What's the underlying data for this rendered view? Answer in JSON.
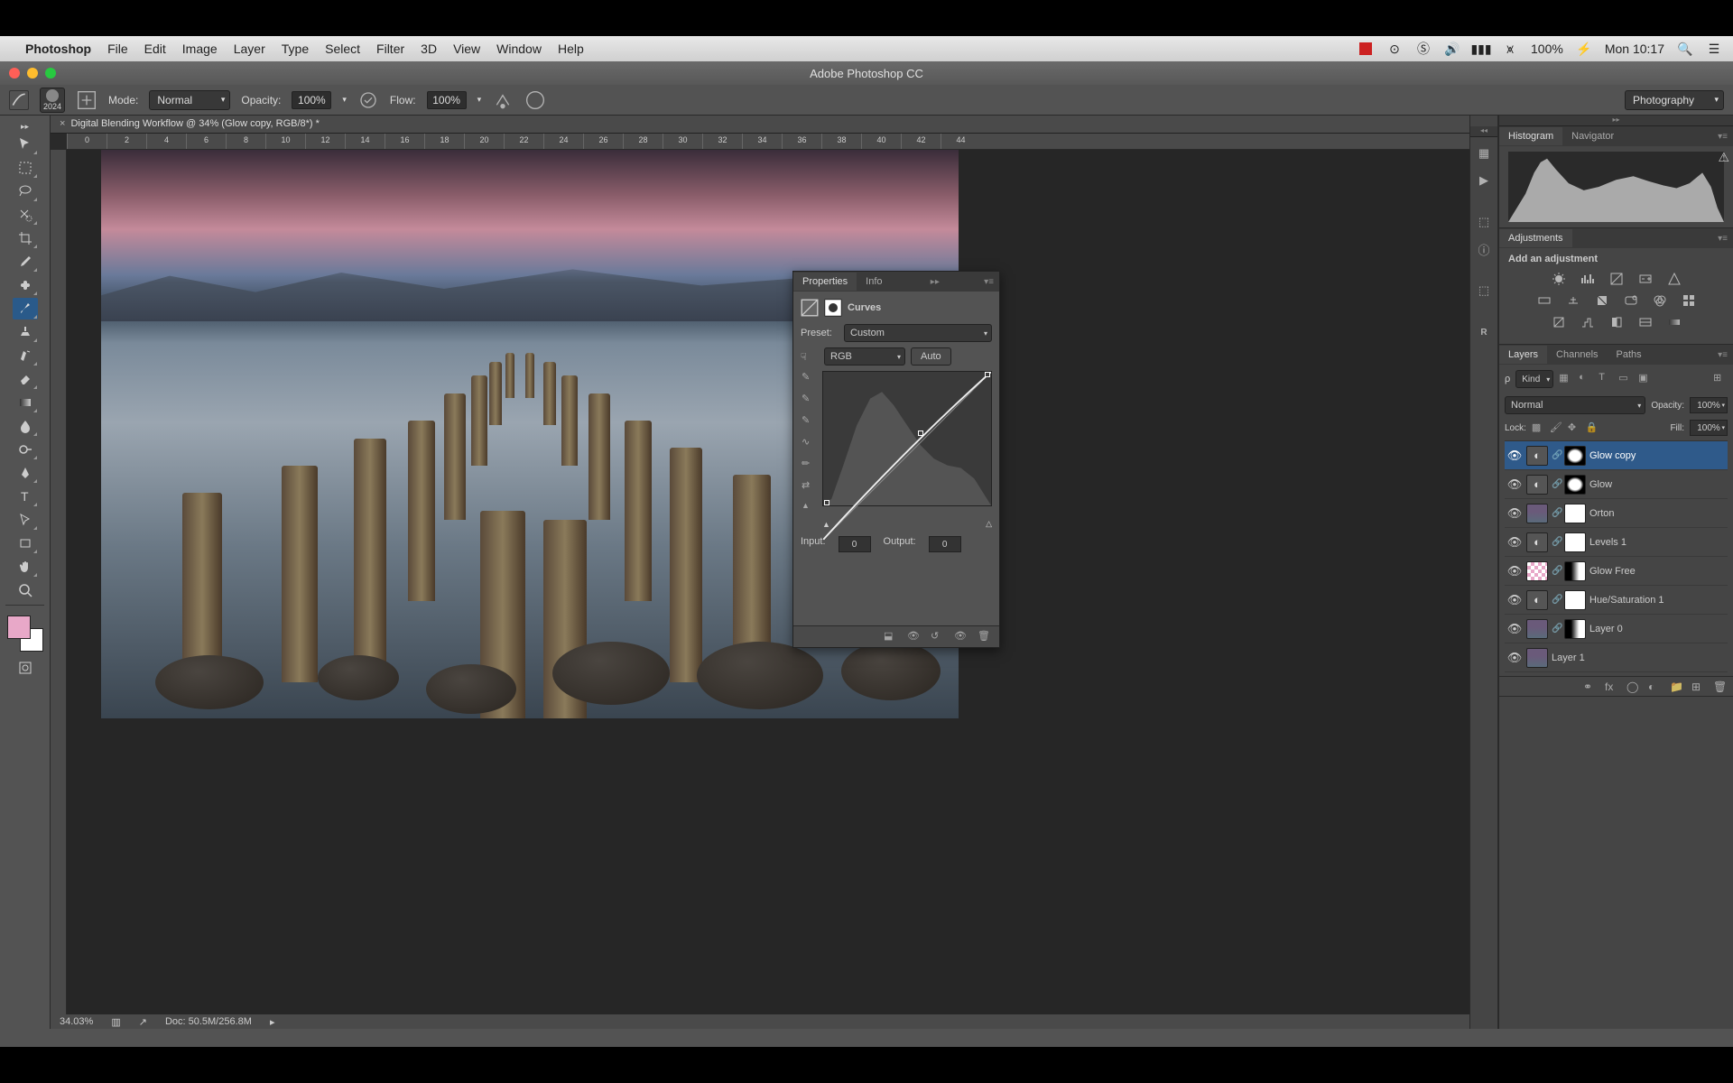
{
  "menubar": {
    "app": "Photoshop",
    "items": [
      "File",
      "Edit",
      "Image",
      "Layer",
      "Type",
      "Select",
      "Filter",
      "3D",
      "View",
      "Window",
      "Help"
    ],
    "battery": "100%",
    "clock": "Mon 10:17"
  },
  "window": {
    "title": "Adobe Photoshop CC"
  },
  "options": {
    "brush_size": "2024",
    "mode_label": "Mode:",
    "mode_value": "Normal",
    "opacity_label": "Opacity:",
    "opacity_value": "100%",
    "flow_label": "Flow:",
    "flow_value": "100%",
    "workspace": "Photography"
  },
  "document": {
    "tab": "Digital Blending Workflow @ 34% (Glow copy, RGB/8*) *",
    "zoom": "34.03%",
    "docsize": "Doc: 50.5M/256.8M",
    "ruler_marks": [
      "0",
      "2",
      "4",
      "6",
      "8",
      "10",
      "12",
      "14",
      "16",
      "18",
      "20",
      "22",
      "24",
      "26",
      "28",
      "30",
      "32",
      "34",
      "36",
      "38",
      "40",
      "42",
      "44"
    ]
  },
  "panels": {
    "histogram_tab": "Histogram",
    "navigator_tab": "Navigator",
    "adjustments_tab": "Adjustments",
    "adjustments_hint": "Add an adjustment",
    "layers_tab": "Layers",
    "channels_tab": "Channels",
    "paths_tab": "Paths"
  },
  "layers_panel": {
    "kind": "Kind",
    "blend_mode": "Normal",
    "opacity_label": "Opacity:",
    "opacity_value": "100%",
    "lock_label": "Lock:",
    "fill_label": "Fill:",
    "fill_value": "100%",
    "layers": [
      {
        "name": "Glow copy",
        "type": "adj",
        "mask": "oval",
        "selected": true
      },
      {
        "name": "Glow",
        "type": "adj",
        "mask": "oval"
      },
      {
        "name": "Orton",
        "type": "img",
        "mask": "white"
      },
      {
        "name": "Levels 1",
        "type": "adj",
        "mask": "white"
      },
      {
        "name": "Glow Free",
        "type": "pink",
        "mask": "grad"
      },
      {
        "name": "Hue/Saturation 1",
        "type": "adj",
        "mask": "white"
      },
      {
        "name": "Layer 0",
        "type": "img",
        "mask": "grad"
      },
      {
        "name": "Layer 1",
        "type": "img",
        "mask": ""
      }
    ]
  },
  "properties": {
    "tab_properties": "Properties",
    "tab_info": "Info",
    "title": "Curves",
    "preset_label": "Preset:",
    "preset_value": "Custom",
    "channel_value": "RGB",
    "auto": "Auto",
    "input_label": "Input:",
    "input_value": "0",
    "output_label": "Output:",
    "output_value": "0"
  }
}
